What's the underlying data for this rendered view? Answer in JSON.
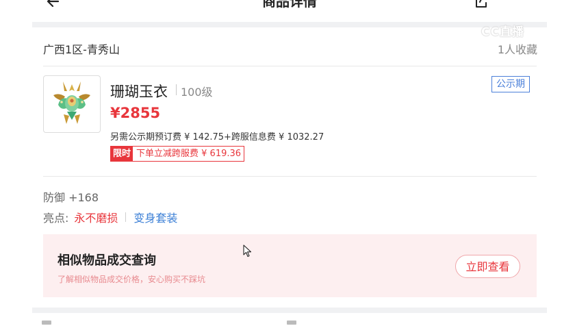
{
  "header": {
    "title": "商品详情",
    "back_icon": "arrow-left-icon",
    "share_icon": "share-icon",
    "more_icon": "more-dots-icon"
  },
  "listing": {
    "server": "广西1区-青秀山",
    "favorites": "1人收藏",
    "status_badge": "公示期",
    "item": {
      "name": "珊瑚玉衣",
      "level": "100级",
      "price": "¥2855",
      "fee_note": "另需公示期预订费 ¥ 142.75+跨服信息费 ¥ 1032.27",
      "promo_tag": "限时",
      "promo_text": "下单立减跨服费 ¥ 619.36"
    },
    "stats": {
      "defense": "防御 +168"
    },
    "highlights": {
      "label": "亮点:",
      "items": [
        "永不磨损",
        "变身套装"
      ]
    }
  },
  "similar_trades": {
    "title": "相似物品成交查询",
    "subtitle": "了解相似物品成交价格，安心购买不踩坑",
    "button_label": "立即查看"
  },
  "watermark": "CC直播",
  "colors": {
    "accent_red": "#e8363c",
    "badge_blue": "#4a7fd9",
    "link_blue": "#3b7fd6",
    "panel_pink": "#fdeff0"
  }
}
